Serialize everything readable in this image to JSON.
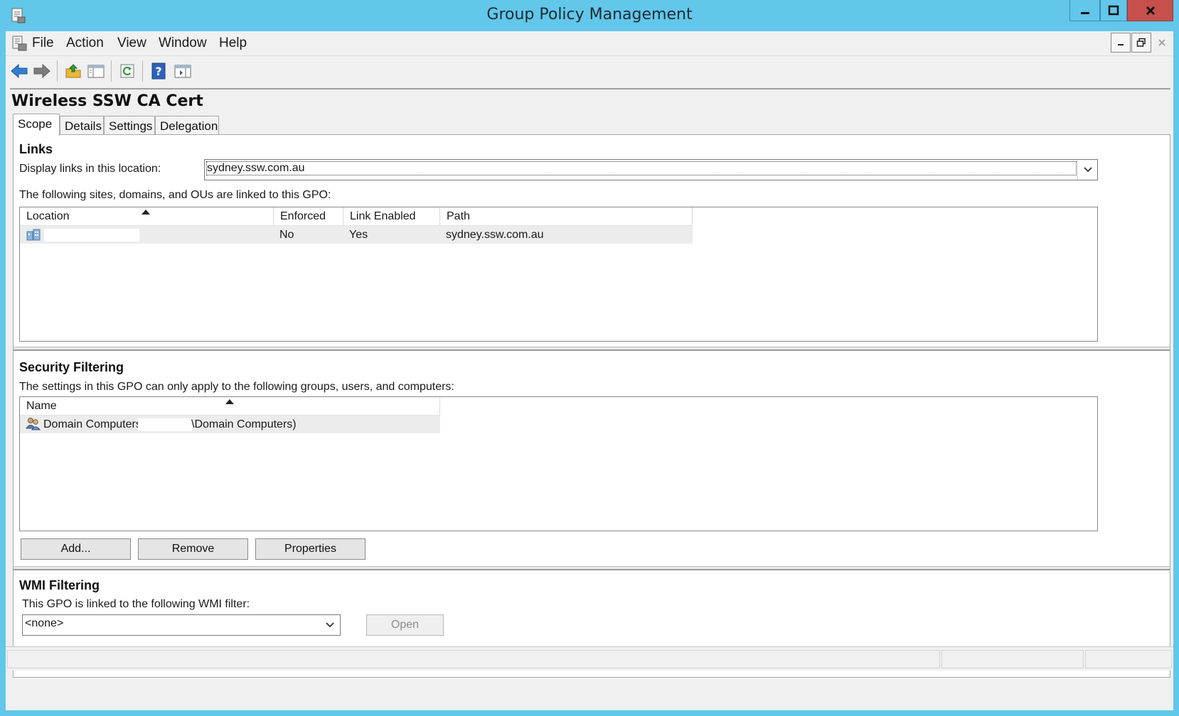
{
  "window": {
    "title": "Group Policy Management",
    "colors": {
      "frame": "#62c7ea",
      "close": "#c7504a"
    }
  },
  "menu": {
    "items": [
      {
        "label": "File"
      },
      {
        "label": "Action"
      },
      {
        "label": "View"
      },
      {
        "label": "Window"
      },
      {
        "label": "Help"
      }
    ]
  },
  "toolbar": {
    "icons": [
      "back-arrow-icon",
      "forward-arrow-icon",
      "up-folder-icon",
      "show-hide-console-tree-icon",
      "refresh-icon",
      "help-icon",
      "show-hide-action-pane-icon"
    ]
  },
  "gpo": {
    "name": "Wireless SSW CA Cert"
  },
  "tabs": [
    {
      "label": "Scope",
      "active": true
    },
    {
      "label": "Details",
      "active": false
    },
    {
      "label": "Settings",
      "active": false
    },
    {
      "label": "Delegation",
      "active": false
    }
  ],
  "links": {
    "section_title": "Links",
    "location_label": "Display links in this location:",
    "location_value": "sydney.ssw.com.au",
    "list_caption": "The following sites, domains, and OUs are linked to this GPO:",
    "columns": [
      "Location",
      "Enforced",
      "Link Enabled",
      "Path"
    ],
    "rows": [
      {
        "location": "",
        "enforced": "No",
        "link_enabled": "Yes",
        "path": "sydney.ssw.com.au"
      }
    ]
  },
  "security_filtering": {
    "section_title": "Security Filtering",
    "caption": "The settings in this GPO can only apply to the following groups, users, and computers:",
    "columns": [
      "Name"
    ],
    "rows": [
      {
        "name_prefix": "Domain Computers (",
        "name_suffix": "\\Domain Computers)"
      }
    ],
    "buttons": {
      "add": "Add...",
      "remove": "Remove",
      "properties": "Properties"
    }
  },
  "wmi_filtering": {
    "section_title": "WMI Filtering",
    "caption": "This GPO is linked to the following WMI filter:",
    "selected": "<none>",
    "open_button": "Open"
  }
}
